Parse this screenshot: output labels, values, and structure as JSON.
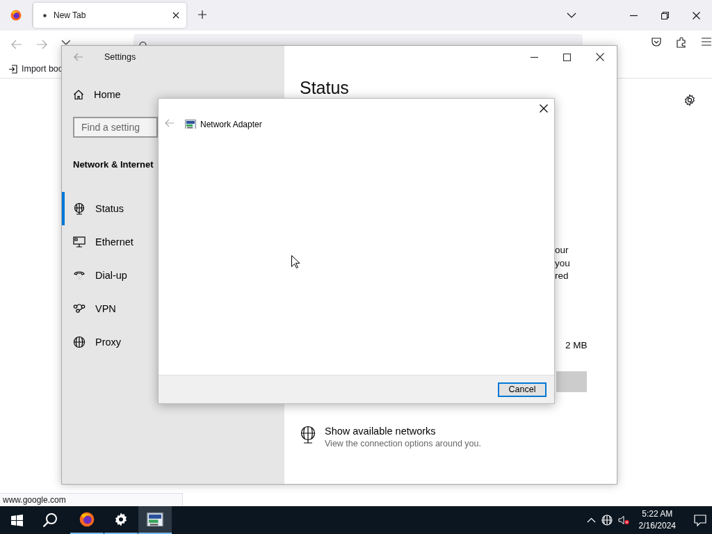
{
  "browser": {
    "tabs": [
      {
        "label": "New Tab",
        "selected": true
      }
    ],
    "bookmarks": [
      "Import boo"
    ],
    "status_link": "www.google.com"
  },
  "settings_window": {
    "title": "Settings",
    "home": "Home",
    "search": {
      "placeholder": "Find a setting"
    },
    "section": "Network & Internet",
    "nav": [
      {
        "kind": "status",
        "label": "Status",
        "selected": true
      },
      {
        "kind": "ethernet",
        "label": "Ethernet",
        "selected": false
      },
      {
        "kind": "dialup",
        "label": "Dial-up",
        "selected": false
      },
      {
        "kind": "vpn",
        "label": "VPN",
        "selected": false
      },
      {
        "kind": "proxy",
        "label": "Proxy",
        "selected": false
      }
    ],
    "page_title": "Status",
    "fragments": [
      "our",
      "you",
      "red"
    ],
    "usage": "2 MB",
    "link": {
      "title": "Show available networks",
      "description": "View the connection options around you."
    }
  },
  "dialog": {
    "title": "Network Adapter",
    "buttons": [
      {
        "label": "Cancel",
        "focused": true
      }
    ]
  },
  "taskbar": {
    "apps": [
      {
        "kind": "firefox",
        "running": true,
        "active": false
      },
      {
        "kind": "settings",
        "running": true,
        "active": false
      },
      {
        "kind": "adapter",
        "running": true,
        "active": true
      }
    ],
    "clock": {
      "time": "5:22 AM",
      "date": "2/16/2024"
    }
  }
}
